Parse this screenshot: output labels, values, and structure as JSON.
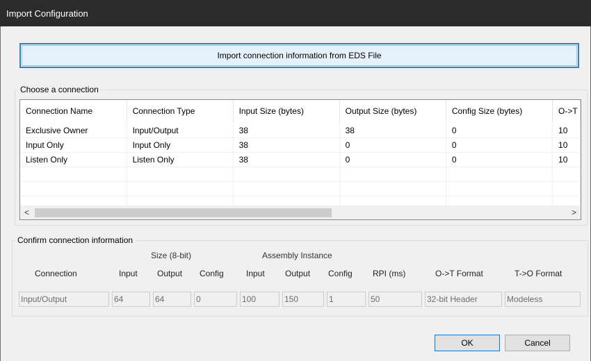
{
  "window": {
    "title": "Import Configuration"
  },
  "import_button_label": "Import connection information from EDS File",
  "choose_group": {
    "label": "Choose a connection",
    "columns": [
      "Connection Name",
      "Connection Type",
      "Input Size (bytes)",
      "Output Size (bytes)",
      "Config Size (bytes)",
      "O->T"
    ],
    "rows": [
      [
        "Exclusive Owner",
        "Input/Output",
        "38",
        "38",
        "0",
        "10"
      ],
      [
        "Input Only",
        "Input Only",
        "38",
        "0",
        "0",
        "10"
      ],
      [
        "Listen Only",
        "Listen Only",
        "38",
        "0",
        "0",
        "10"
      ]
    ],
    "scroll_left_icon": "<",
    "scroll_right_icon": ">"
  },
  "confirm_group": {
    "label": "Confirm connection information",
    "size_header": "Size (8-bit)",
    "assembly_header": "Assembly Instance",
    "col_connection": "Connection",
    "col_input": "Input",
    "col_output": "Output",
    "col_config": "Config",
    "col_asm_input": "Input",
    "col_asm_output": "Output",
    "col_asm_config": "Config",
    "col_rpi": "RPI (ms)",
    "col_ot_format": "O->T Format",
    "col_to_format": "T->O Format",
    "values": {
      "connection": "Input/Output",
      "input": "64",
      "output": "64",
      "config": "0",
      "asm_input": "100",
      "asm_output": "150",
      "asm_config": "1",
      "rpi": "50",
      "ot_format": "32-bit Header",
      "to_format": "Modeless"
    }
  },
  "buttons": {
    "ok": "OK",
    "cancel": "Cancel"
  },
  "colors": {
    "titlebar": "#2b2b2b",
    "accent": "#0078d7",
    "import_border": "#3c7fb1"
  }
}
